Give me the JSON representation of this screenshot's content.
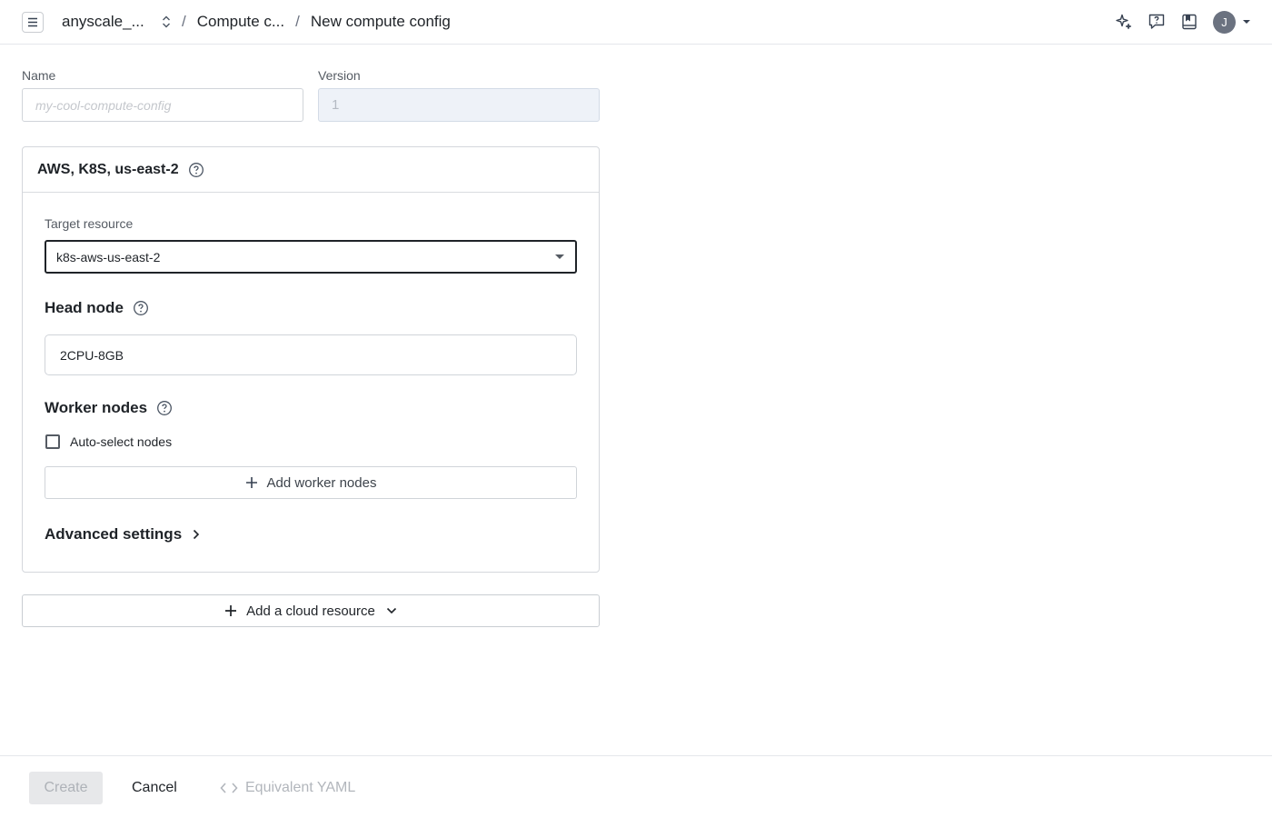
{
  "topbar": {
    "project": "anyscale_...",
    "breadcrumb_separator": "/",
    "breadcrumb_parent": "Compute c...",
    "breadcrumb_current": "New compute config",
    "avatar_initial": "J"
  },
  "form": {
    "name_label": "Name",
    "name_placeholder": "my-cool-compute-config",
    "name_value": "",
    "version_label": "Version",
    "version_value": "1"
  },
  "cloud": {
    "title": "AWS, K8S, us-east-2",
    "target_resource_label": "Target resource",
    "target_resource_value": "k8s-aws-us-east-2",
    "head_node_title": "Head node",
    "head_node_value": "2CPU-8GB",
    "worker_nodes_title": "Worker nodes",
    "auto_select_label": "Auto-select nodes",
    "auto_select_checked": false,
    "add_worker_label": "Add worker nodes",
    "advanced_label": "Advanced settings"
  },
  "add_cloud_label": "Add a cloud resource",
  "footer": {
    "create_label": "Create",
    "cancel_label": "Cancel",
    "yaml_label": "Equivalent YAML"
  },
  "icons": {
    "menu": "hamburger-menu-icon",
    "switch": "unfold-arrows-icon",
    "assistant": "sparkle-icon",
    "help": "help-chat-icon",
    "docs": "book-icon",
    "info": "question-circle-icon"
  },
  "colors": {
    "text": "#1f2328",
    "muted": "#555b63",
    "border": "#d0d4d9",
    "disabled_bg": "#eef2f8"
  }
}
